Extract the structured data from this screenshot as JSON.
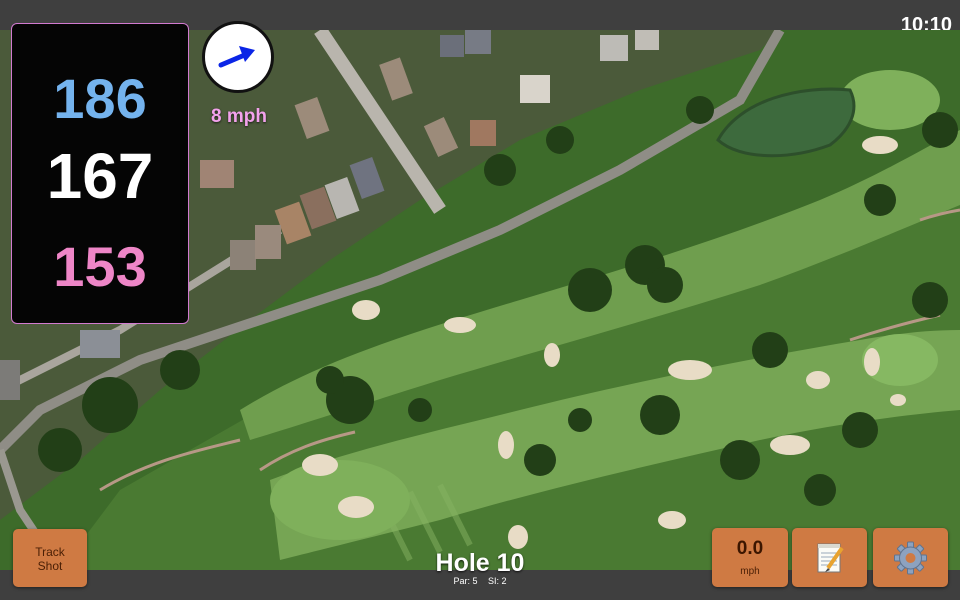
{
  "status_bar": {
    "time": "10:10"
  },
  "distances": {
    "back": "186",
    "middle": "167",
    "front": "153"
  },
  "wind": {
    "speed_label": "8 mph",
    "icon": "wind-direction-arrow-icon"
  },
  "hole": {
    "title": "Hole 10",
    "par_label": "Par: 5",
    "si_label": "SI: 2"
  },
  "buttons": {
    "track_shot_line1": "Track",
    "track_shot_line2": "Shot",
    "speed_value": "0.0",
    "speed_unit": "mph",
    "notes_icon": "notepad-icon",
    "settings_icon": "gear-icon"
  },
  "colors": {
    "back_distance": "#74b3ee",
    "middle_distance": "#ffffff",
    "front_distance": "#ee86c7",
    "wind_text": "#f3a2ec",
    "button": "#cf7a43"
  }
}
